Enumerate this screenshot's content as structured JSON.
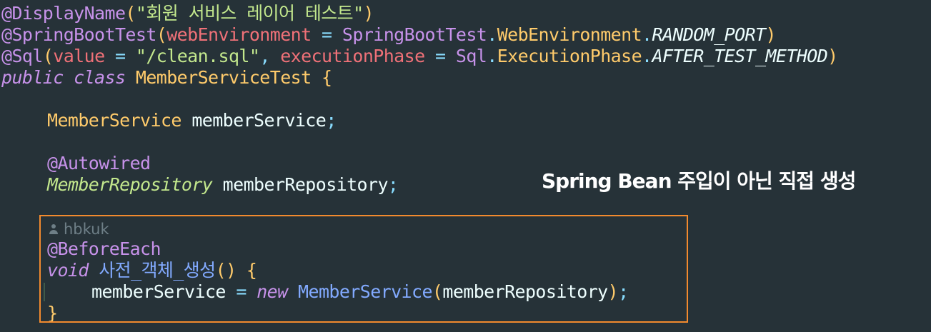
{
  "code": {
    "display_name": {
      "annotation": "@DisplayName",
      "open": "(",
      "value": "\"회원 서비스 레이어 테스트\"",
      "close": ")"
    },
    "spring_boot_test": {
      "annotation": "@SpringBootTest",
      "open": "(",
      "param": "webEnvironment",
      "eq": " = ",
      "cls": "SpringBootTest",
      "dot1": ".",
      "inner": "WebEnvironment",
      "dot2": ".",
      "constant": "RANDOM_PORT",
      "close": ")"
    },
    "sql": {
      "annotation": "@Sql",
      "open": "(",
      "param1": "value",
      "eq1": " = ",
      "value": "\"/clean.sql\"",
      "comma": ", ",
      "param2": "executionPhase",
      "eq2": " = ",
      "cls": "Sql",
      "dot1": ".",
      "inner": "ExecutionPhase",
      "dot2": ".",
      "constant": "AFTER_TEST_METHOD",
      "close": ")"
    },
    "class_decl": {
      "modifiers": "public class ",
      "name": "MemberServiceTest",
      "brace": " {"
    },
    "field1": {
      "type": "MemberService",
      "name": " memberService",
      "semi": ";"
    },
    "autowired": "@Autowired",
    "field2": {
      "type": "MemberRepository",
      "name": " memberRepository",
      "semi": ";"
    },
    "author": "hbkuk",
    "before_each": "@BeforeEach",
    "method_decl": {
      "kw": "void ",
      "name": "사전_객체_생성",
      "parens": "()",
      "brace": " {"
    },
    "assign": {
      "target": "memberService",
      "eq": " = ",
      "new": "new ",
      "ctor": "MemberService",
      "open": "(",
      "arg": "memberRepository",
      "close": ")",
      "semi": ";"
    },
    "closing_brace": "}"
  },
  "overlay_note": "Spring Bean 주입이 아닌 직접 생성",
  "colors": {
    "background": "#263238",
    "highlight_border": "#f28a2e"
  },
  "icons": {
    "author": "person-icon"
  }
}
